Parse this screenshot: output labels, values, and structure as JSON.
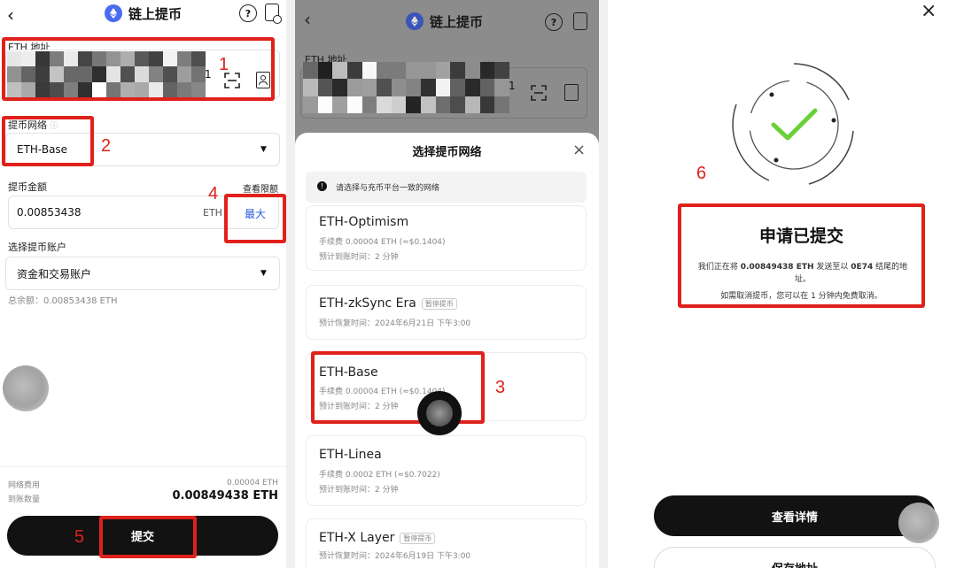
{
  "panel1": {
    "header": {
      "title": "链上提币"
    },
    "address": {
      "label": "ETH 地址",
      "suffix": "1"
    },
    "network": {
      "label": "提币网络",
      "value": "ETH-Base"
    },
    "amount": {
      "label": "提币金额",
      "limit_link": "查看限额",
      "value": "0.00853438",
      "unit": "ETH",
      "max_button": "最大"
    },
    "account": {
      "label": "选择提币账户",
      "value": "资金和交易账户"
    },
    "balance": "总余额：0.00853438 ETH",
    "fee": {
      "label": "网络费用",
      "value": "0.00004 ETH"
    },
    "received": {
      "label": "到账数量",
      "value": "0.00849438 ETH"
    },
    "submit_button": "提交",
    "annotations": [
      "1",
      "2",
      "4",
      "5"
    ]
  },
  "panel2": {
    "header": {
      "title": "链上提币"
    },
    "address": {
      "label": "ETH 地址",
      "suffix": "1"
    },
    "sheet": {
      "title": "选择提币网络",
      "notice": "请选择与充币平台一致的网络",
      "networks": [
        {
          "name": "ETH-Optimism",
          "line1": "手续费 0.00004 ETH (≈$0.1404)",
          "line2": "预计到账时间：2 分钟",
          "tag": ""
        },
        {
          "name": "ETH-zkSync Era",
          "line1": "预计恢复时间：2024年6月21日 下午3:00",
          "line2": "",
          "tag": "暂停提币"
        },
        {
          "name": "ETH-Base",
          "line1": "手续费 0.00004 ETH (≈$0.1404)",
          "line2": "预计到账时间：2 分钟",
          "tag": ""
        },
        {
          "name": "ETH-Linea",
          "line1": "手续费 0.0002 ETH (≈$0.7022)",
          "line2": "预计到账时间：2 分钟",
          "tag": ""
        },
        {
          "name": "ETH-X Layer",
          "line1": "预计恢复时间：2024年6月19日 下午3:00",
          "line2": "",
          "tag": "暂停提币"
        }
      ]
    },
    "annotations": [
      "3"
    ]
  },
  "panel3": {
    "title": "申请已提交",
    "message1_a": "我们正在将",
    "message1_amount": "0.00849438 ETH",
    "message1_b": "发送至以",
    "message1_suffix": "0E74",
    "message1_c": "结尾的地",
    "message1_d": "址。",
    "message2": "如需取消提币，您可以在 1 分钟内免费取消。",
    "details_button": "查看详情",
    "save_address_button": "保存地址",
    "annotations": [
      "6"
    ]
  },
  "colors": {
    "accent_blue": "#2a5bd7",
    "annotation_red": "#e0211b",
    "success_green": "#6ad13a",
    "dark_button": "#121212"
  },
  "icons": [
    "back-arrow-icon",
    "eth-logo-icon",
    "help-icon",
    "record-icon",
    "scan-icon",
    "contacts-icon",
    "chevron-down-icon",
    "info-icon",
    "close-icon",
    "check-icon"
  ]
}
